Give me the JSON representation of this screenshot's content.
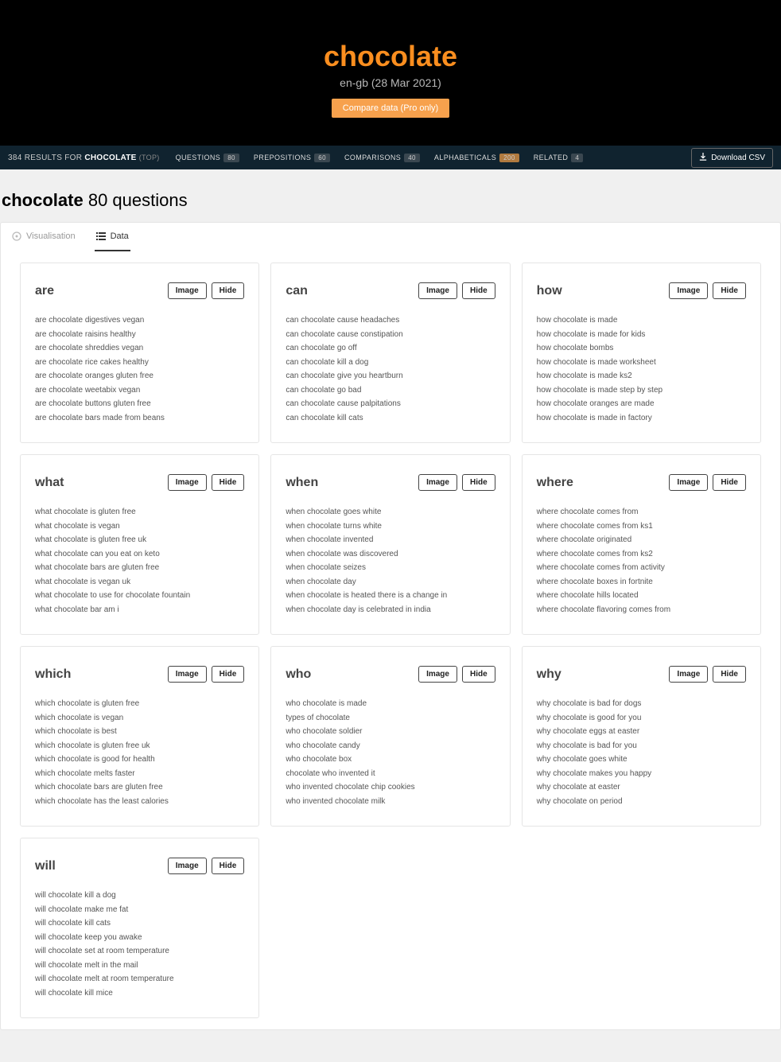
{
  "hero": {
    "title": "chocolate",
    "subtitle": "en-gb (28 Mar 2021)",
    "button": "Compare data (Pro only)"
  },
  "nav": {
    "resultsCount": "384",
    "resultsWord": "RESULTS FOR",
    "keyword": "CHOCOLATE",
    "top": "(TOP)",
    "links": [
      {
        "label": "QUESTIONS",
        "badge": "80"
      },
      {
        "label": "PREPOSITIONS",
        "badge": "60"
      },
      {
        "label": "COMPARISONS",
        "badge": "40"
      },
      {
        "label": "ALPHABETICALS",
        "badge": "200"
      },
      {
        "label": "RELATED",
        "badge": "4"
      }
    ],
    "download": "Download CSV"
  },
  "section": {
    "keyword": "chocolate",
    "count": "80 questions"
  },
  "tabs": {
    "vis": "Visualisation",
    "data": "Data"
  },
  "buttons": {
    "image": "Image",
    "hide": "Hide"
  },
  "cards": [
    {
      "title": "are",
      "items": [
        "are chocolate digestives vegan",
        "are chocolate raisins healthy",
        "are chocolate shreddies vegan",
        "are chocolate rice cakes healthy",
        "are chocolate oranges gluten free",
        "are chocolate weetabix vegan",
        "are chocolate buttons gluten free",
        "are chocolate bars made from beans"
      ]
    },
    {
      "title": "can",
      "items": [
        "can chocolate cause headaches",
        "can chocolate cause constipation",
        "can chocolate go off",
        "can chocolate kill a dog",
        "can chocolate give you heartburn",
        "can chocolate go bad",
        "can chocolate cause palpitations",
        "can chocolate kill cats"
      ]
    },
    {
      "title": "how",
      "items": [
        "how chocolate is made",
        "how chocolate is made for kids",
        "how chocolate bombs",
        "how chocolate is made worksheet",
        "how chocolate is made ks2",
        "how chocolate is made step by step",
        "how chocolate oranges are made",
        "how chocolate is made in factory"
      ]
    },
    {
      "title": "what",
      "items": [
        "what chocolate is gluten free",
        "what chocolate is vegan",
        "what chocolate is gluten free uk",
        "what chocolate can you eat on keto",
        "what chocolate bars are gluten free",
        "what chocolate is vegan uk",
        "what chocolate to use for chocolate fountain",
        "what chocolate bar am i"
      ]
    },
    {
      "title": "when",
      "items": [
        "when chocolate goes white",
        "when chocolate turns white",
        "when chocolate invented",
        "when chocolate was discovered",
        "when chocolate seizes",
        "when chocolate day",
        "when chocolate is heated there is a change in",
        "when chocolate day is celebrated in india"
      ]
    },
    {
      "title": "where",
      "items": [
        "where chocolate comes from",
        "where chocolate comes from ks1",
        "where chocolate originated",
        "where chocolate comes from ks2",
        "where chocolate comes from activity",
        "where chocolate boxes in fortnite",
        "where chocolate hills located",
        "where chocolate flavoring comes from"
      ]
    },
    {
      "title": "which",
      "items": [
        "which chocolate is gluten free",
        "which chocolate is vegan",
        "which chocolate is best",
        "which chocolate is gluten free uk",
        "which chocolate is good for health",
        "which chocolate melts faster",
        "which chocolate bars are gluten free",
        "which chocolate has the least calories"
      ]
    },
    {
      "title": "who",
      "items": [
        "who chocolate is made",
        "types of chocolate",
        "who chocolate soldier",
        "who chocolate candy",
        "who chocolate box",
        "chocolate who invented it",
        "who invented chocolate chip cookies",
        "who invented chocolate milk"
      ]
    },
    {
      "title": "why",
      "items": [
        "why chocolate is bad for dogs",
        "why chocolate is good for you",
        "why chocolate eggs at easter",
        "why chocolate is bad for you",
        "why chocolate goes white",
        "why chocolate makes you happy",
        "why chocolate at easter",
        "why chocolate on period"
      ]
    }
  ],
  "lastCard": {
    "title": "will",
    "items": [
      "will chocolate kill a dog",
      "will chocolate make me fat",
      "will chocolate kill cats",
      "will chocolate keep you awake",
      "will chocolate set at room temperature",
      "will chocolate melt in the mail",
      "will chocolate melt at room temperature",
      "will chocolate kill mice"
    ]
  }
}
